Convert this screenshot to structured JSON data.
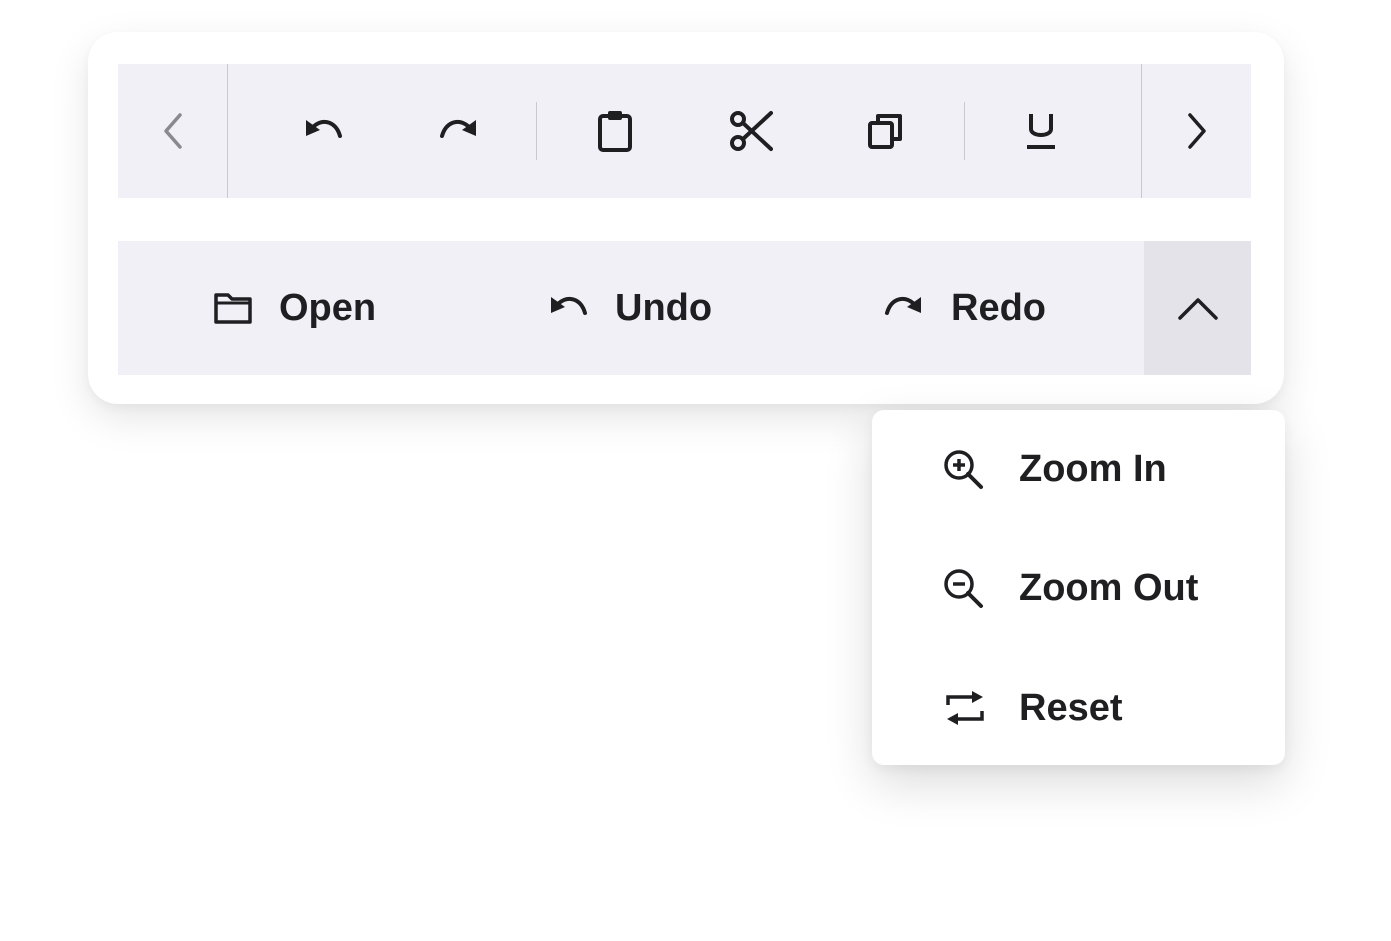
{
  "toolbar_scroll": {
    "prev_icon": "chevron-left-icon",
    "next_icon": "chevron-right-icon",
    "items": [
      {
        "icon": "undo-icon"
      },
      {
        "icon": "redo-icon"
      },
      {
        "icon": "clipboard-icon"
      },
      {
        "icon": "scissors-icon"
      },
      {
        "icon": "copy-icon"
      },
      {
        "icon": "underline-icon"
      }
    ]
  },
  "toolbar_labels": {
    "open_label": "Open",
    "undo_label": "Undo",
    "redo_label": "Redo",
    "overflow_icon": "chevron-up-icon"
  },
  "popup_menu": {
    "zoom_in_label": "Zoom In",
    "zoom_out_label": "Zoom Out",
    "reset_label": "Reset"
  },
  "colors": {
    "toolbar_bg": "#f1f0f6",
    "overflow_active_bg": "#e4e3e9",
    "text": "#1f1f22",
    "disabled": "#8a8990"
  }
}
